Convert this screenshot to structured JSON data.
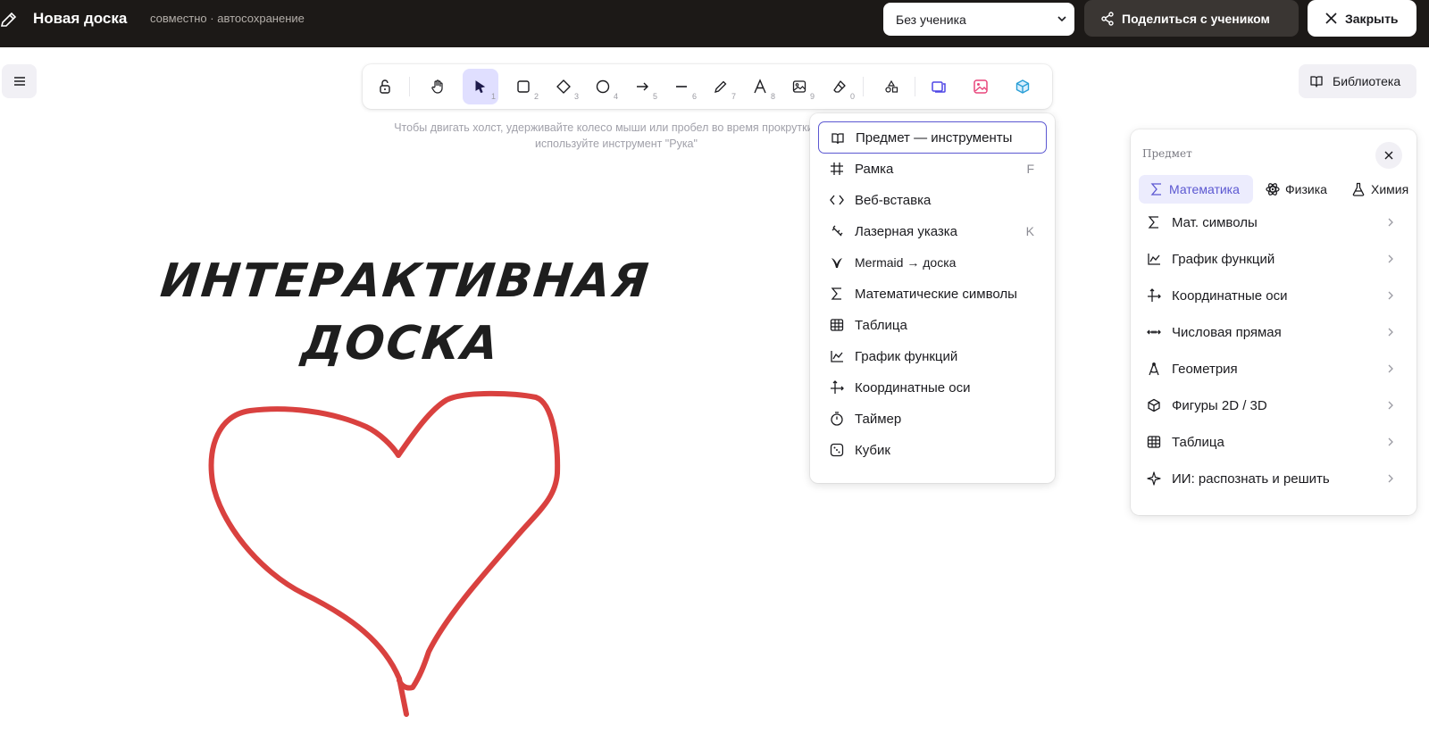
{
  "topbar": {
    "title": "Новая доска",
    "subtitle": "совместно · автосохранение",
    "student_select": "Без ученика",
    "share_label": "Поделиться с учеником",
    "close_label": "Закрыть"
  },
  "toolbar": {
    "tools": [
      {
        "name": "lock",
        "num": ""
      },
      {
        "name": "hand",
        "num": ""
      },
      {
        "name": "selection",
        "num": "1"
      },
      {
        "name": "rectangle",
        "num": "2"
      },
      {
        "name": "diamond",
        "num": "3"
      },
      {
        "name": "ellipse",
        "num": "4"
      },
      {
        "name": "arrow",
        "num": "5"
      },
      {
        "name": "line",
        "num": "6"
      },
      {
        "name": "draw",
        "num": "7"
      },
      {
        "name": "text",
        "num": "8"
      },
      {
        "name": "image",
        "num": "9"
      },
      {
        "name": "eraser",
        "num": "0"
      }
    ],
    "hint": "Чтобы двигать холст, удерживайте колесо мыши или пробел во время прокрутки, или используйте инструмент \"Рука\""
  },
  "library_label": "Библиотека",
  "dropdown": {
    "items": [
      {
        "label": "Предмет — инструменты",
        "shortcut": ""
      },
      {
        "label": "Рамка",
        "shortcut": "F"
      },
      {
        "label": "Веб-вставка",
        "shortcut": ""
      },
      {
        "label": "Лазерная указка",
        "shortcut": "K"
      },
      {
        "label": "Mermaid → доска",
        "shortcut": ""
      },
      {
        "label": "Математические символы",
        "shortcut": ""
      },
      {
        "label": "Таблица",
        "shortcut": ""
      },
      {
        "label": "График функций",
        "shortcut": ""
      },
      {
        "label": "Координатные оси",
        "shortcut": ""
      },
      {
        "label": "Таймер",
        "shortcut": ""
      },
      {
        "label": "Кубик",
        "shortcut": ""
      }
    ]
  },
  "panel": {
    "title": "Предмет",
    "tabs": [
      "Математика",
      "Физика",
      "Химия"
    ],
    "items": [
      "Мат. символы",
      "График функций",
      "Координатные оси",
      "Числовая прямая",
      "Геометрия",
      "Фигуры 2D / 3D",
      "Таблица",
      "ИИ: распознать и решить"
    ]
  },
  "canvas": {
    "text_line1": "Интерактивная",
    "text_line2": "доска",
    "stroke_color": "#d9413f"
  },
  "colors": {
    "accent": "#5b57d1",
    "topbar_bg": "#1c1917"
  }
}
